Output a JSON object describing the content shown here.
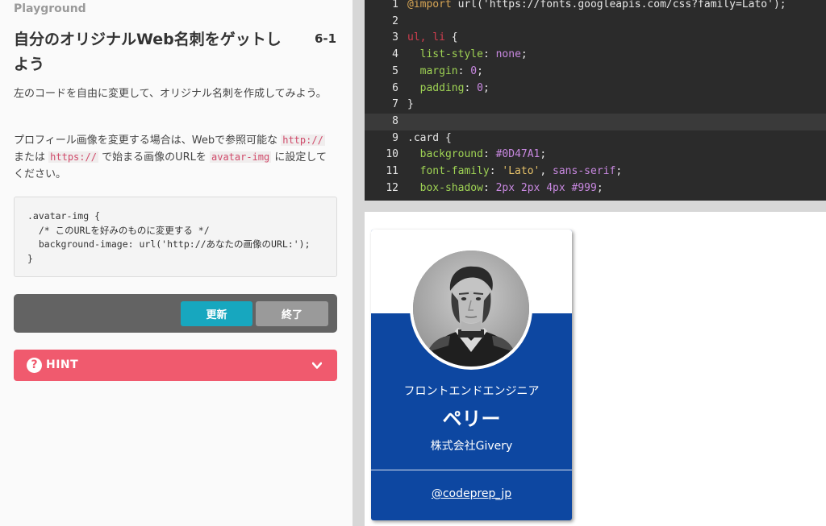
{
  "breadcrumb": "Playground",
  "lesson": {
    "title": "自分のオリジナルWeb名刺をゲットしよう",
    "number": "6-1"
  },
  "instructions": {
    "p1": "左のコードを自由に変更して、オリジナル名刺を作成してみよう。",
    "p2_a": "プロフィール画像を変更する場合は、Webで参照可能な ",
    "p2_code1": "http://",
    "p2_b": " または ",
    "p2_code2": "https://",
    "p2_c": " で始まる画像のURLを ",
    "p2_code3": "avatar-img",
    "p2_d": " に設定してください。"
  },
  "snippet": {
    "l1": ".avatar-img {",
    "l2": "  /* このURLを好みのものに変更する */",
    "l3": "  background-image: url('http://あなたの画像のURL:');",
    "l4": "}"
  },
  "buttons": {
    "update": "更新",
    "finish": "終了"
  },
  "hint": {
    "icon": "?",
    "label": "HINT"
  },
  "editor": {
    "lines": [
      {
        "n": "1",
        "segs": [
          [
            "at",
            "@import "
          ],
          [
            "fn",
            "url('https://fonts.googleapis.com/css?family=Lato');"
          ]
        ]
      },
      {
        "n": "2",
        "segs": []
      },
      {
        "n": "3",
        "segs": [
          [
            "sel",
            "ul, li"
          ],
          [
            "fn",
            " {"
          ]
        ]
      },
      {
        "n": "4",
        "segs": [
          [
            "fn",
            "  "
          ],
          [
            "prop",
            "list-style"
          ],
          [
            "fn",
            ": "
          ],
          [
            "val",
            "none"
          ],
          [
            "fn",
            ";"
          ]
        ]
      },
      {
        "n": "5",
        "segs": [
          [
            "fn",
            "  "
          ],
          [
            "prop",
            "margin"
          ],
          [
            "fn",
            ": "
          ],
          [
            "val",
            "0"
          ],
          [
            "fn",
            ";"
          ]
        ]
      },
      {
        "n": "6",
        "segs": [
          [
            "fn",
            "  "
          ],
          [
            "prop",
            "padding"
          ],
          [
            "fn",
            ": "
          ],
          [
            "val",
            "0"
          ],
          [
            "fn",
            ";"
          ]
        ]
      },
      {
        "n": "7",
        "segs": [
          [
            "fn",
            "}"
          ]
        ]
      },
      {
        "n": "8",
        "segs": [],
        "active": true
      },
      {
        "n": "9",
        "segs": [
          [
            "fn",
            ".card {"
          ]
        ]
      },
      {
        "n": "10",
        "segs": [
          [
            "fn",
            "  "
          ],
          [
            "prop",
            "background"
          ],
          [
            "fn",
            ": "
          ],
          [
            "val",
            "#0D47A1"
          ],
          [
            "fn",
            ";"
          ]
        ]
      },
      {
        "n": "11",
        "segs": [
          [
            "fn",
            "  "
          ],
          [
            "prop",
            "font-family"
          ],
          [
            "fn",
            ": "
          ],
          [
            "str",
            "'Lato'"
          ],
          [
            "fn",
            ", "
          ],
          [
            "val",
            "sans-serif"
          ],
          [
            "fn",
            ";"
          ]
        ]
      },
      {
        "n": "12",
        "segs": [
          [
            "fn",
            "  "
          ],
          [
            "prop",
            "box-shadow"
          ],
          [
            "fn",
            ": "
          ],
          [
            "val",
            "2px 2px 4px #999"
          ],
          [
            "fn",
            ";"
          ]
        ]
      }
    ]
  },
  "card": {
    "job": "フロントエンドエンジニア",
    "name": "ペリー",
    "company": "株式会社Givery",
    "link": "@codeprep_jp"
  },
  "colors": {
    "card_bg": "#0D47A1",
    "update_btn": "#17a7bf",
    "hint_bg": "#f05a6e",
    "editor_bg": "#2b2b2b"
  }
}
